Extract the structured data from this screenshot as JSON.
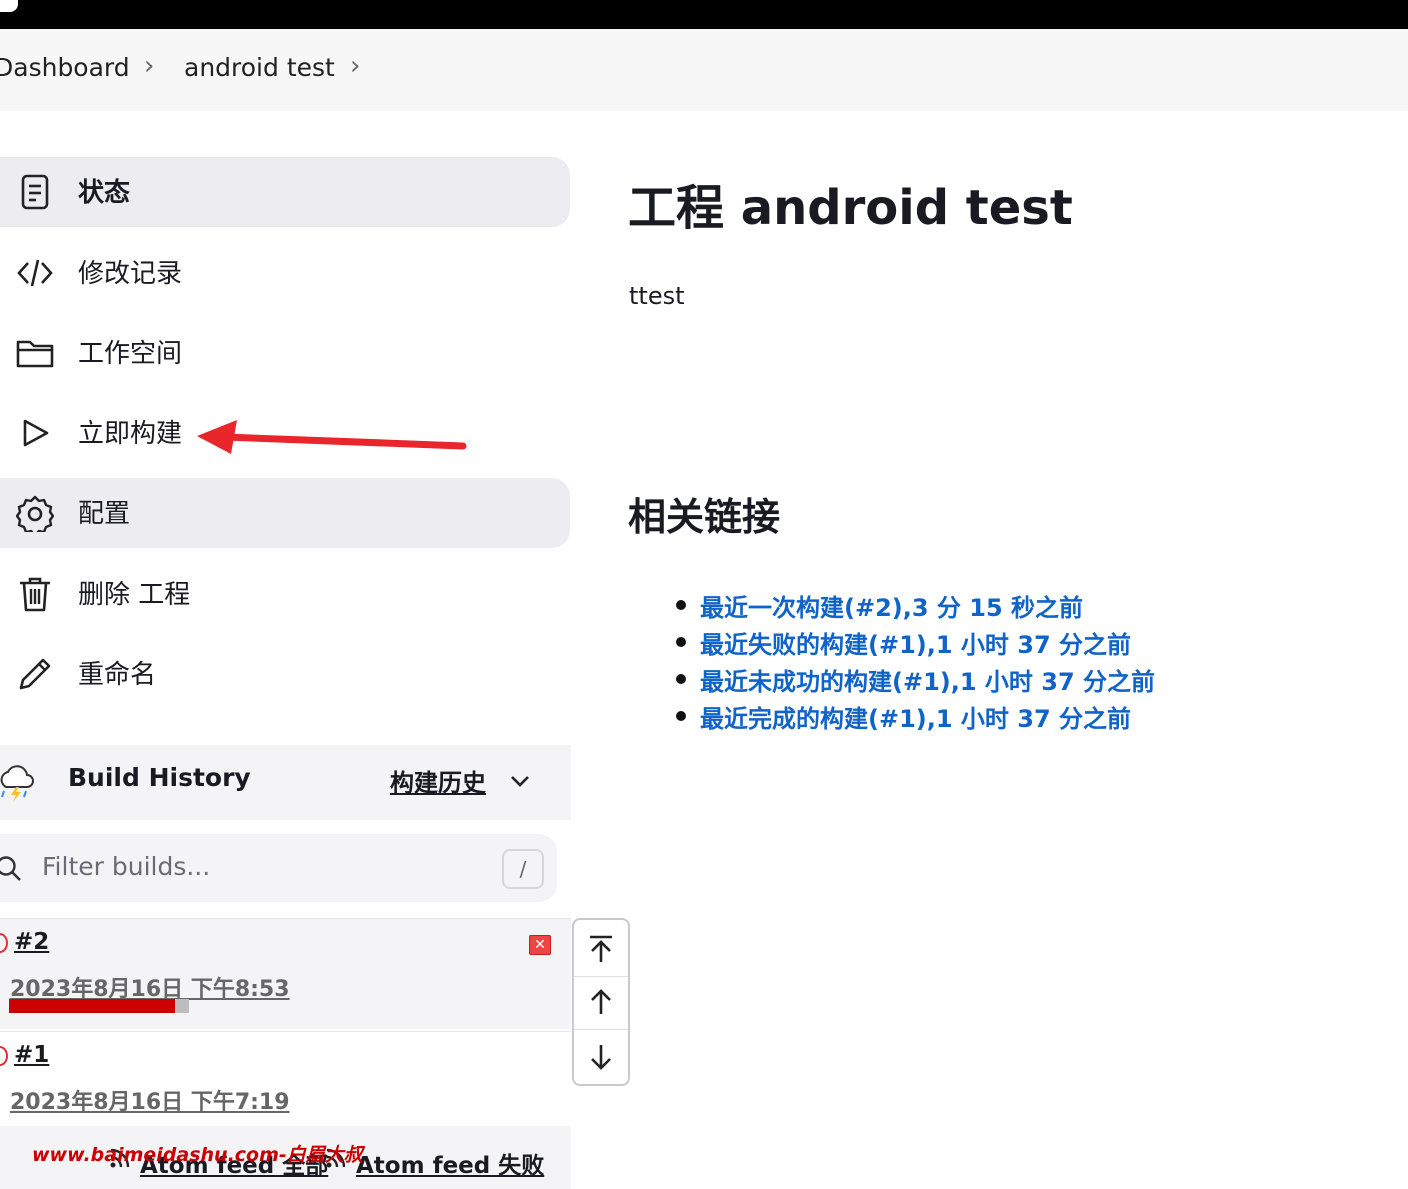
{
  "breadcrumb": {
    "items": [
      "Dashboard",
      "android test"
    ]
  },
  "sidebar": {
    "items": [
      {
        "label": "状态",
        "icon": "document-icon"
      },
      {
        "label": "修改记录",
        "icon": "code-icon"
      },
      {
        "label": "工作空间",
        "icon": "folder-icon"
      },
      {
        "label": "立即构建",
        "icon": "play-icon"
      },
      {
        "label": "配置",
        "icon": "gear-icon"
      },
      {
        "label": "删除 工程",
        "icon": "trash-icon"
      },
      {
        "label": "重命名",
        "icon": "pencil-icon"
      }
    ]
  },
  "build_history": {
    "title": "Build History",
    "trend_label": "构建历史",
    "filter_placeholder": "Filter builds...",
    "filter_shortcut": "/",
    "builds": [
      {
        "number": "#2",
        "date": "2023年8月16日 下午8:53",
        "progress": 0.92
      },
      {
        "number": "#1",
        "date": "2023年8月16日 下午7:19"
      }
    ],
    "feed_all": "Atom feed 全部",
    "feed_failed": "Atom feed 失败",
    "watermark": "www.baimeidashu.com-白眉大叔"
  },
  "main": {
    "title": "工程 android test",
    "description": "ttest",
    "related_title": "相关链接",
    "links": [
      "最近一次构建(#2),3 分 15 秒之前",
      "最近失败的构建(#1),1 小时 37 分之前",
      "最近未成功的构建(#1),1 小时 37 分之前",
      "最近完成的构建(#1),1 小时 37 分之前"
    ]
  },
  "colors": {
    "link": "#1063c8",
    "failure": "#cc0000",
    "annotation_arrow": "#e8262b"
  }
}
